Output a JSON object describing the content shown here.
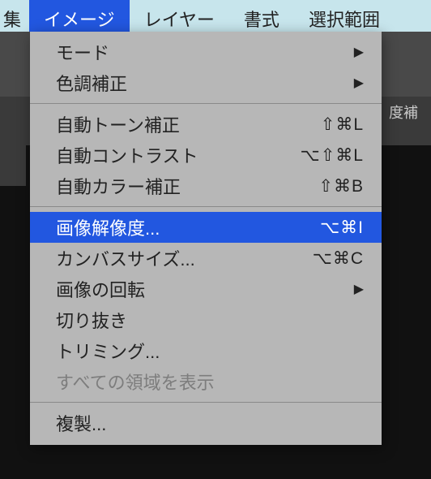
{
  "menubar": {
    "items": [
      {
        "label": "集"
      },
      {
        "label": "イメージ"
      },
      {
        "label": "レイヤー"
      },
      {
        "label": "書式"
      },
      {
        "label": "選択範囲"
      }
    ],
    "open_index": 1
  },
  "background": {
    "toolbar_fragment": "度補"
  },
  "dropdown": {
    "groups": [
      [
        {
          "label": "モード",
          "submenu": true
        },
        {
          "label": "色調補正",
          "submenu": true
        }
      ],
      [
        {
          "label": "自動トーン補正",
          "shortcut": "⇧⌘L"
        },
        {
          "label": "自動コントラスト",
          "shortcut": "⌥⇧⌘L"
        },
        {
          "label": "自動カラー補正",
          "shortcut": "⇧⌘B"
        }
      ],
      [
        {
          "label": "画像解像度...",
          "shortcut": "⌥⌘I",
          "selected": true
        },
        {
          "label": "カンバスサイズ...",
          "shortcut": "⌥⌘C"
        },
        {
          "label": "画像の回転",
          "submenu": true
        },
        {
          "label": "切り抜き"
        },
        {
          "label": "トリミング..."
        },
        {
          "label": "すべての領域を表示",
          "disabled": true
        }
      ],
      [
        {
          "label": "複製..."
        }
      ]
    ]
  }
}
